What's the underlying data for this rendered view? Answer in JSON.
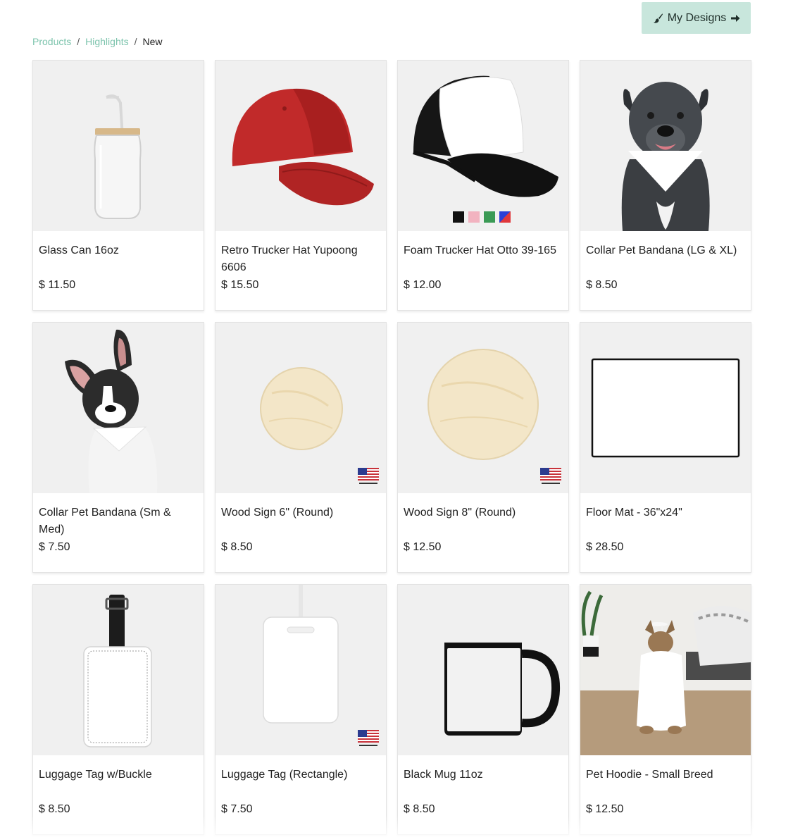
{
  "header": {
    "my_designs_label": "My Designs"
  },
  "breadcrumb": {
    "items": [
      "Products",
      "Highlights"
    ],
    "current": "New",
    "separator": "/"
  },
  "products": [
    {
      "title": "Glass Can 16oz",
      "price": "$ 11.50",
      "image": "glass-can"
    },
    {
      "title": "Retro Trucker Hat Yupoong 6606",
      "price": "$ 15.50",
      "image": "red-trucker-hat"
    },
    {
      "title": "Foam Trucker Hat Otto 39-165",
      "price": "$ 12.00",
      "image": "foam-trucker-hat",
      "swatches": [
        "#111111",
        "#f2b3c0",
        "#3a9a55",
        "#2b3fd6"
      ]
    },
    {
      "title": "Collar Pet Bandana (LG & XL)",
      "price": "$ 8.50",
      "image": "dog-bandana-large"
    },
    {
      "title": "Collar Pet Bandana (Sm & Med)",
      "price": "$ 7.50",
      "image": "dog-bandana-small"
    },
    {
      "title": "Wood Sign 6\" (Round)",
      "price": "$ 8.50",
      "image": "wood-sign-round",
      "made_in_usa": true
    },
    {
      "title": "Wood Sign 8\" (Round)",
      "price": "$ 12.50",
      "image": "wood-sign-round-large",
      "made_in_usa": true
    },
    {
      "title": "Floor Mat - 36\"x24\"",
      "price": "$ 28.50",
      "image": "floor-mat"
    },
    {
      "title": "Luggage Tag w/Buckle",
      "price": "$ 8.50",
      "image": "luggage-tag-buckle"
    },
    {
      "title": "Luggage Tag (Rectangle)",
      "price": "$ 7.50",
      "image": "luggage-tag-rect",
      "made_in_usa": true
    },
    {
      "title": "Black Mug 11oz",
      "price": "$ 8.50",
      "image": "black-mug"
    },
    {
      "title": "Pet Hoodie - Small Breed",
      "price": "$ 12.50",
      "image": "pet-hoodie"
    }
  ],
  "made_in_usa_badge": "MADE IN USA",
  "colors": {
    "accent": "#c8e6dc",
    "link": "#7dc4ad",
    "thumb_bg": "#f0f0f0"
  }
}
